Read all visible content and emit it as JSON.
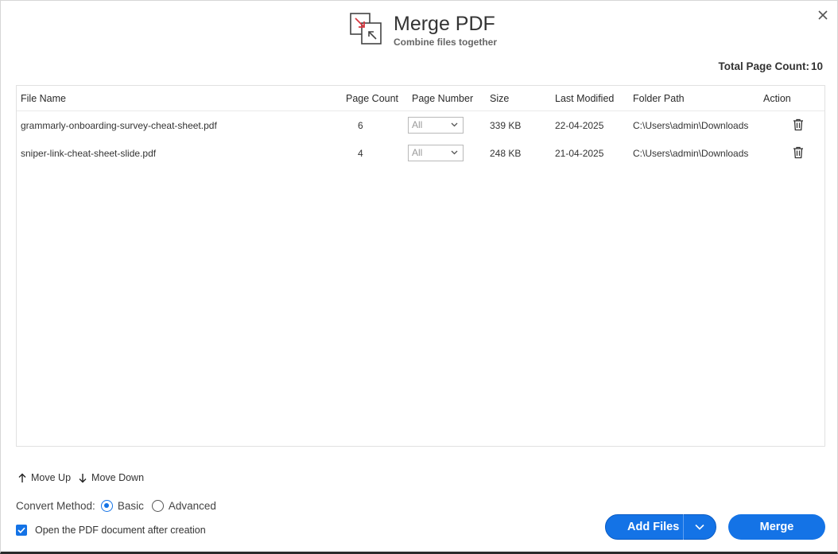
{
  "dialog": {
    "title": "Merge PDF",
    "subtitle": "Combine files together",
    "close_icon": "close-icon",
    "total_page_count_label": "Total Page Count:",
    "total_page_count_value": "10"
  },
  "table": {
    "headers": {
      "file_name": "File Name",
      "page_count": "Page Count",
      "page_number": "Page Number",
      "size": "Size",
      "last_modified": "Last Modified",
      "folder_path": "Folder Path",
      "action": "Action"
    },
    "rows": [
      {
        "file_name": "grammarly-onboarding-survey-cheat-sheet.pdf",
        "page_count": "6",
        "page_number": "All",
        "size": "339 KB",
        "last_modified": "22-04-2025",
        "folder_path": "C:\\Users\\admin\\Downloads"
      },
      {
        "file_name": "sniper-link-cheat-sheet-slide.pdf",
        "page_count": "4",
        "page_number": "All",
        "size": "248 KB",
        "last_modified": "21-04-2025",
        "folder_path": "C:\\Users\\admin\\Downloads"
      }
    ]
  },
  "controls": {
    "move_up": "Move Up",
    "move_down": "Move Down",
    "convert_method_label": "Convert Method:",
    "convert_options": [
      "Basic",
      "Advanced"
    ],
    "convert_selected": "Basic",
    "open_after_creation": "Open the PDF document after creation",
    "open_after_creation_checked": true
  },
  "buttons": {
    "add_files": "Add Files",
    "merge": "Merge"
  },
  "colors": {
    "accent": "#1473e6",
    "logo_red": "#d7373f"
  }
}
